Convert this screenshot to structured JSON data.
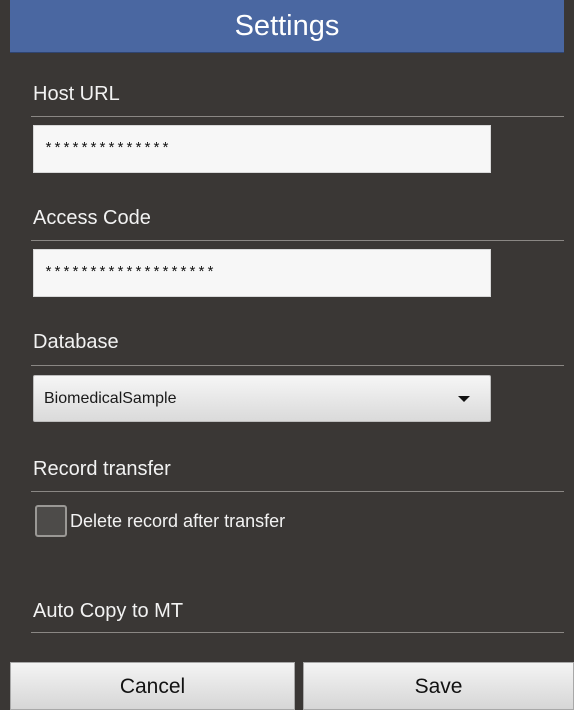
{
  "header": {
    "title": "Settings"
  },
  "host_url": {
    "label": "Host URL",
    "value": "**************"
  },
  "access_code": {
    "label": "Access Code",
    "value": "*******************"
  },
  "database": {
    "label": "Database",
    "selected": "BiomedicalSample",
    "icon": "chevron-down-icon"
  },
  "record_transfer": {
    "label": "Record transfer",
    "checkbox_label": "Delete record after transfer",
    "checked": false
  },
  "auto_copy": {
    "label": "Auto Copy to MT"
  },
  "buttons": {
    "cancel": "Cancel",
    "save": "Save"
  },
  "colors": {
    "background": "#3a3735",
    "titlebar": "#4a67a1",
    "text": "#f2f2f2"
  }
}
